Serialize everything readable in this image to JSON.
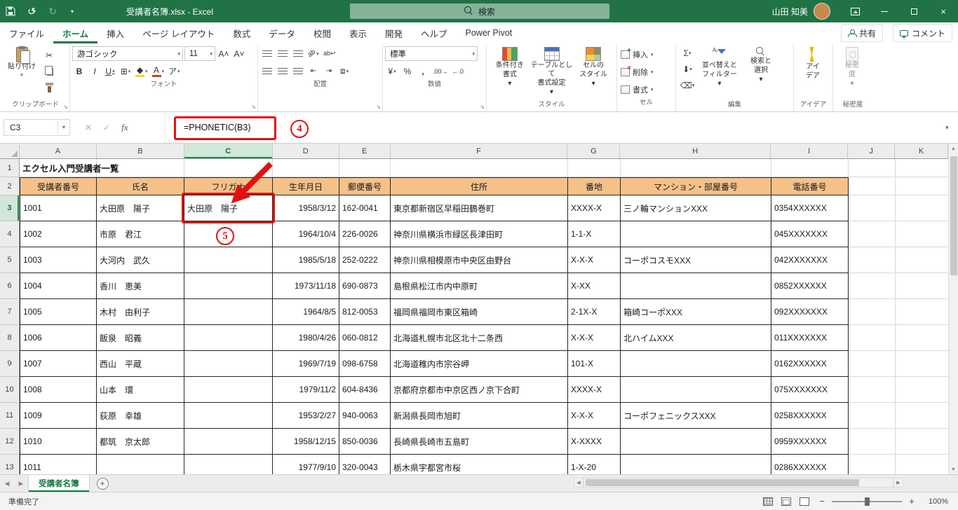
{
  "titlebar": {
    "file_name": "受講者名簿.xlsx  -  Excel",
    "search_placeholder": "検索",
    "user_name": "山田 知美"
  },
  "ribbon": {
    "tabs": [
      "ファイル",
      "ホーム",
      "挿入",
      "ページ レイアウト",
      "数式",
      "データ",
      "校閲",
      "表示",
      "開発",
      "ヘルプ",
      "Power Pivot"
    ],
    "active_tab": "ホーム",
    "share": "共有",
    "comments": "コメント",
    "clipboard": {
      "paste": "貼り付け",
      "label": "クリップボード"
    },
    "font": {
      "name": "游ゴシック",
      "size": "11",
      "bold": "B",
      "italic": "I",
      "underline": "U",
      "phonetic": "ア",
      "label": "フォント"
    },
    "align": {
      "label": "配置",
      "wrap": "ab"
    },
    "number": {
      "format": "標準",
      "currency": "¥",
      "percent": "%",
      "comma": ",",
      "inc_dec": ".00",
      "dec_dec": ".0",
      "label": "数値"
    },
    "styles": {
      "cond1": "条件付き",
      "cond2": "書式",
      "table1": "テーブルとして",
      "table2": "書式設定",
      "cell1": "セルの",
      "cell2": "スタイル",
      "label": "スタイル"
    },
    "cells": {
      "insert": "挿入",
      "delete": "削除",
      "format": "書式",
      "label": "セル"
    },
    "editing": {
      "sum": "Σ",
      "sort1": "並べ替えと",
      "sort2": "フィルター",
      "find1": "検索と",
      "find2": "選択",
      "label": "編集"
    },
    "ideas": {
      "line1": "アイ",
      "line2": "デア",
      "label": "アイデア"
    },
    "sensitivity": {
      "line1": "秘密",
      "line2": "度",
      "label": "秘密度"
    }
  },
  "formula_bar": {
    "name_box": "C3",
    "fx": "fx",
    "formula": "=PHONETIC(B3)"
  },
  "annotations": {
    "step4": "4",
    "step5": "5"
  },
  "grid": {
    "columns": [
      "A",
      "B",
      "C",
      "D",
      "E",
      "F",
      "G",
      "H",
      "I",
      "J",
      "K"
    ],
    "selected_col": "C",
    "selected_row": "3",
    "rows": [
      {
        "num": "1",
        "type": "title",
        "cells": [
          "エクセル入門受講者一覧",
          "",
          "",
          "",
          "",
          "",
          "",
          "",
          ""
        ]
      },
      {
        "num": "2",
        "type": "header",
        "cells": [
          "受講者番号",
          "氏名",
          "フリガナ",
          "生年月日",
          "郵便番号",
          "住所",
          "番地",
          "マンション・部屋番号",
          "電話番号"
        ]
      },
      {
        "num": "3",
        "type": "data",
        "cells": [
          "1001",
          "大田原　陽子",
          "大田原　陽子",
          "1958/3/12",
          "162-0041",
          "東京都新宿区早稲田鶴巻町",
          "XXXX-X",
          "三ノ輪マンションXXX",
          "0354XXXXXX"
        ]
      },
      {
        "num": "4",
        "type": "data",
        "cells": [
          "1002",
          "市原　君江",
          "",
          "1964/10/4",
          "226-0026",
          "神奈川県横浜市緑区長津田町",
          "1-1-X",
          "",
          "045XXXXXXX"
        ]
      },
      {
        "num": "5",
        "type": "data",
        "cells": [
          "1003",
          "大河内　武久",
          "",
          "1985/5/18",
          "252-0222",
          "神奈川県相模原市中央区由野台",
          "X-X-X",
          "コーポコスモXXX",
          "042XXXXXXX"
        ]
      },
      {
        "num": "6",
        "type": "data",
        "cells": [
          "1004",
          "香川　恵美",
          "",
          "1973/11/18",
          "690-0873",
          "島根県松江市内中原町",
          "X-XX",
          "",
          "0852XXXXXX"
        ]
      },
      {
        "num": "7",
        "type": "data",
        "cells": [
          "1005",
          "木村　由利子",
          "",
          "1964/8/5",
          "812-0053",
          "福岡県福岡市東区箱崎",
          "2-1X-X",
          "箱崎コーポXXX",
          "092XXXXXXX"
        ]
      },
      {
        "num": "8",
        "type": "data",
        "cells": [
          "1006",
          "飯泉　昭義",
          "",
          "1980/4/26",
          "060-0812",
          "北海道札幌市北区北十二条西",
          "X-X-X",
          "北ハイムXXX",
          "011XXXXXXX"
        ]
      },
      {
        "num": "9",
        "type": "data",
        "cells": [
          "1007",
          "西山　平蔵",
          "",
          "1969/7/19",
          "098-6758",
          "北海道稚内市宗谷岬",
          "101-X",
          "",
          "0162XXXXXX"
        ]
      },
      {
        "num": "10",
        "type": "data",
        "cells": [
          "1008",
          "山本　環",
          "",
          "1979/11/2",
          "604-8436",
          "京都府京都市中京区西ノ京下合町",
          "XXXX-X",
          "",
          "075XXXXXXX"
        ]
      },
      {
        "num": "11",
        "type": "data",
        "cells": [
          "1009",
          "荻原　幸雄",
          "",
          "1953/2/27",
          "940-0063",
          "新潟県長岡市旭町",
          "X-X-X",
          "コーポフェニックスXXX",
          "0258XXXXXX"
        ]
      },
      {
        "num": "12",
        "type": "data",
        "cells": [
          "1010",
          "都筑　京太郎",
          "",
          "1958/12/15",
          "850-0036",
          "長崎県長崎市五島町",
          "X-XXXX",
          "",
          "0959XXXXXX"
        ]
      },
      {
        "num": "13",
        "type": "data",
        "cells": [
          "1011",
          "",
          "",
          "1977/9/10",
          "320-0043",
          "栃木県宇都宮市桜",
          "1-X-20",
          "",
          "0286XXXXXX"
        ]
      }
    ]
  },
  "sheet": {
    "active_tab": "受講者名簿"
  },
  "status": {
    "ready": "準備完了",
    "zoom": "100%"
  }
}
